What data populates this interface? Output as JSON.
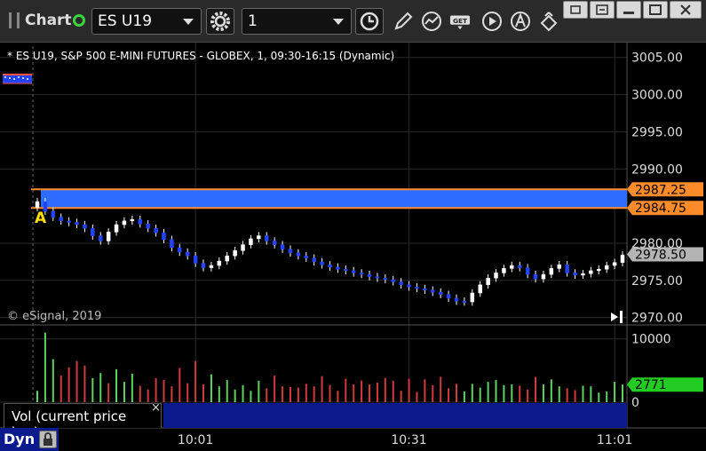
{
  "toolbar": {
    "title": "Chart",
    "symbol": "ES U19",
    "interval": "1"
  },
  "chart_header": "* ES U19, S&P 500 E-MINI FUTURES - GLOBEX, 1, 09:30-16:15 (Dynamic)",
  "copyright": "© eSignal, 2019",
  "marker_label": "A",
  "volume_tab": {
    "label": "Vol (current price bar)",
    "close": "×"
  },
  "dyn_label": "Dyn",
  "colors": {
    "up_candle": "#ffffff",
    "down_candle": "#2244ff",
    "band": "#2e6bff",
    "band_edge": "#ff8c2a",
    "volume_up": "#5fd35f",
    "volume_down": "#d23b3b",
    "current_price": "#b4b4b4",
    "current_volume": "#22cc22"
  },
  "chart_data": {
    "type": "candlestick",
    "title": "ES U19, S&P 500 E-MINI FUTURES - GLOBEX, 1, 09:30-16:15 (Dynamic)",
    "y_ticks": [
      "3005.00",
      "3000.00",
      "2995.00",
      "2990.00",
      "2980.00",
      "2975.00",
      "2970.00"
    ],
    "ylim": [
      2969,
      3007
    ],
    "x_ticks": [
      "10:01",
      "10:31",
      "11:01"
    ],
    "price_markers": [
      {
        "label": "2987.25",
        "value": 2987.25,
        "color": "#ff8c2a"
      },
      {
        "label": "2984.75",
        "value": 2984.75,
        "color": "#ff8c2a"
      },
      {
        "label": "2978.50",
        "value": 2978.5,
        "color": "#b4b4b4"
      }
    ],
    "band": {
      "from": 2984.75,
      "to": 2987.25
    },
    "close_path": [
      2985.6,
      2984.3,
      2983.5,
      2983.0,
      2982.8,
      2982.5,
      2982.0,
      2981.0,
      2980.3,
      2981.5,
      2982.5,
      2983.0,
      2983.2,
      2982.6,
      2982.0,
      2981.4,
      2980.5,
      2979.4,
      2978.8,
      2978.3,
      2977.3,
      2976.7,
      2977.0,
      2977.6,
      2978.3,
      2979.0,
      2979.8,
      2980.6,
      2981.0,
      2980.3,
      2979.8,
      2979.2,
      2978.7,
      2978.3,
      2978.0,
      2977.5,
      2977.1,
      2976.8,
      2976.5,
      2976.3,
      2976.0,
      2975.8,
      2975.5,
      2975.3,
      2975.1,
      2974.8,
      2974.4,
      2974.1,
      2973.9,
      2973.7,
      2973.4,
      2973.1,
      2972.6,
      2972.2,
      2972.1,
      2973.3,
      2974.4,
      2975.3,
      2976.0,
      2976.6,
      2977.0,
      2976.7,
      2975.8,
      2975.2,
      2975.8,
      2976.6,
      2977.1,
      2976.0,
      2975.7,
      2975.9,
      2976.3,
      2976.5,
      2977.0,
      2977.4,
      2978.4
    ],
    "volume": {
      "y_ticks": [
        "10000",
        "0"
      ],
      "ylim": [
        0,
        11500
      ],
      "current": {
        "label": "2771",
        "value": 2771
      },
      "bars": [
        1800,
        11000,
        6800,
        4200,
        5500,
        6500,
        5800,
        3800,
        4600,
        3000,
        5200,
        3200,
        4500,
        2600,
        2000,
        3800,
        3500,
        2500,
        5400,
        3000,
        6500,
        2800,
        4400,
        2500,
        3500,
        2000,
        2700,
        1800,
        3400,
        2200,
        4200,
        2500,
        2400,
        2300,
        2900,
        2500,
        4100,
        2700,
        1800,
        3700,
        2800,
        3400,
        2800,
        3100,
        3800,
        3400,
        1800,
        3700,
        1600,
        3600,
        2700,
        4000,
        2200,
        2900,
        1700,
        2900,
        2300,
        3200,
        3500,
        2700,
        2800,
        2600,
        2000,
        4000,
        2800,
        3600,
        2500,
        2200,
        1900,
        2600,
        2500,
        1500,
        1700,
        3200,
        2771
      ],
      "directions": [
        "u",
        "u",
        "u",
        "d",
        "d",
        "d",
        "d",
        "u",
        "u",
        "d",
        "u",
        "u",
        "u",
        "d",
        "d",
        "d",
        "d",
        "d",
        "d",
        "d",
        "d",
        "d",
        "u",
        "u",
        "u",
        "u",
        "u",
        "u",
        "u",
        "d",
        "d",
        "d",
        "d",
        "d",
        "d",
        "d",
        "d",
        "d",
        "d",
        "d",
        "d",
        "d",
        "d",
        "d",
        "d",
        "d",
        "d",
        "d",
        "d",
        "d",
        "d",
        "d",
        "d",
        "d",
        "u",
        "u",
        "u",
        "u",
        "u",
        "u",
        "u",
        "d",
        "d",
        "d",
        "u",
        "u",
        "u",
        "d",
        "d",
        "u",
        "u",
        "u",
        "u",
        "u",
        "u"
      ]
    }
  }
}
